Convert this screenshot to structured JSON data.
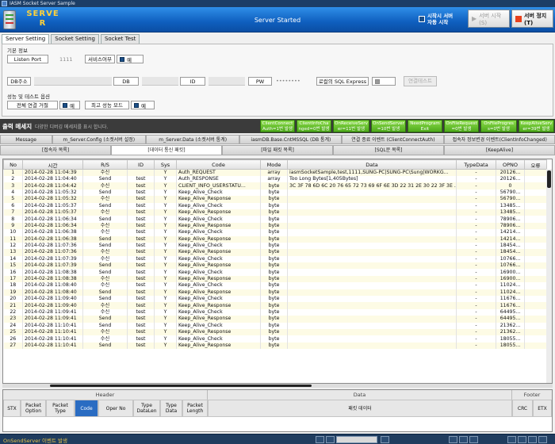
{
  "window": {
    "title": "IASM Socket Server Sample"
  },
  "banner": {
    "brand_line1": "SERVE",
    "brand_line2": "R",
    "status": "Server Started",
    "auto_start_line1": "시작시 서버",
    "auto_start_line2": "자동 시작",
    "start_button": "서버 시작(S)",
    "stop_button": "서버 정지(T)"
  },
  "tabs": [
    "Server Setting",
    "Socket Setting",
    "Socket Test"
  ],
  "settings": {
    "basic_group": "기본 정보",
    "listen_port_label": "Listen Port",
    "listen_port_value": "1111",
    "service_label": "서비스여부",
    "service_value": "예",
    "db_label": "DB주소",
    "db_name_label": "DB",
    "id_label": "ID",
    "pw_label": "PW",
    "pw_value": "••••••••",
    "local_sql_label": "로컬의 SQL Express",
    "connect_button": "연결테스트",
    "perf_group": "성능 및 테스트 옵션",
    "deny_all_label": "전체 연결 거절",
    "deny_all_value": "예",
    "max_perf_label": "최고 성능 모드",
    "max_perf_value": "예"
  },
  "messages": {
    "title": "출력 메세지",
    "subtitle": "다양한 디버깅 메세지를 표시 합니다.",
    "event_buttons": [
      {
        "line1": "ClientConnect",
        "line2": "Auth=1번 발생"
      },
      {
        "line1": "ClientInfoCha",
        "line2": "nged=0번 발생"
      },
      {
        "line1": "OnReceiveServ",
        "line2": "er=11번 발생"
      },
      {
        "line1": "OnSendServer",
        "line2": "=10번 발생"
      },
      {
        "line1": "NeedProgram",
        "line2": "Exit"
      },
      {
        "line1": "OnFileRequest",
        "line2": "=0번 발생"
      },
      {
        "line1": "OnFileProgres",
        "line2": "s=0번 발생"
      },
      {
        "line1": "KeepAliveServ",
        "line2": "er=39번 발생"
      }
    ]
  },
  "msg_tabs_row1": [
    "Message",
    "m_Server.Config (소켓서버 설정)",
    "m_Server.Data (소켓서버 통계)",
    "iasmDB.Base.CntMSSQL (DB 통계)",
    "연결 종료 이벤트 (ClientConnectAuth)",
    "접속자 정보변경 이벤트(ClientInfoChanged)"
  ],
  "msg_tabs_row2": [
    "[접속자 목록]",
    "[데이터 통신 패킷]",
    "[파일 패킷 목록]",
    "[SQL문 목록]",
    "[KeepAlive]"
  ],
  "grid": {
    "columns": [
      "No",
      "시간",
      "R/S",
      "ID",
      "Sys",
      "Code",
      "Mode",
      "Data",
      "TypeData",
      "OPNO",
      "오류"
    ],
    "rows": [
      [
        "1",
        "2014-02-28 11:04:39",
        "수신",
        "",
        "Y",
        "Auth_REQUEST",
        "array",
        "iasmSocketSample,test,1111,SUNG-PC|SUNG-PC\\Sung|WORKG...",
        "-",
        "20126...",
        ""
      ],
      [
        "2",
        "2014-02-28 11:04:40",
        "Send",
        "test",
        "Y",
        "Auth_RESPONSE",
        "array",
        "Too Long Bytes[1,405Bytes]",
        "-",
        "20126...",
        ""
      ],
      [
        "3",
        "2014-02-28 11:04:42",
        "수신",
        "test",
        "Y",
        "CLIENT_INFO_USERSTATU...",
        "byte",
        "3C 3F 78 6D 6C 20 76 65 72 73 69 6F 6E 3D 22 31 2E 30 22 3F 3E ...",
        "-",
        "0",
        ""
      ],
      [
        "4",
        "2014-02-28 11:05:32",
        "Send",
        "test",
        "Y",
        "Keep_Alive_Check",
        "byte",
        "",
        "-",
        "56790...",
        ""
      ],
      [
        "5",
        "2014-02-28 11:05:32",
        "수신",
        "test",
        "Y",
        "Keep_Alive_Response",
        "byte",
        "",
        "-",
        "56790...",
        ""
      ],
      [
        "6",
        "2014-02-28 11:05:37",
        "Send",
        "test",
        "Y",
        "Keep_Alive_Check",
        "byte",
        "",
        "-",
        "13485...",
        ""
      ],
      [
        "7",
        "2014-02-28 11:05:37",
        "수신",
        "test",
        "Y",
        "Keep_Alive_Response",
        "byte",
        "",
        "-",
        "13485...",
        ""
      ],
      [
        "8",
        "2014-02-28 11:06:34",
        "Send",
        "test",
        "Y",
        "Keep_Alive_Check",
        "byte",
        "",
        "-",
        "78906...",
        ""
      ],
      [
        "9",
        "2014-02-28 11:06:34",
        "수신",
        "test",
        "Y",
        "Keep_Alive_Response",
        "byte",
        "",
        "-",
        "78906...",
        ""
      ],
      [
        "10",
        "2014-02-28 11:06:38",
        "수신",
        "test",
        "Y",
        "Keep_Alive_Check",
        "byte",
        "",
        "-",
        "14214...",
        ""
      ],
      [
        "11",
        "2014-02-28 11:06:38",
        "Send",
        "test",
        "Y",
        "Keep_Alive_Response",
        "byte",
        "",
        "-",
        "14214...",
        ""
      ],
      [
        "12",
        "2014-02-28 11:07:36",
        "Send",
        "test",
        "Y",
        "Keep_Alive_Check",
        "byte",
        "",
        "-",
        "18454...",
        ""
      ],
      [
        "13",
        "2014-02-28 11:07:36",
        "수신",
        "test",
        "Y",
        "Keep_Alive_Response",
        "byte",
        "",
        "-",
        "18454...",
        ""
      ],
      [
        "14",
        "2014-02-28 11:07:39",
        "수신",
        "test",
        "Y",
        "Keep_Alive_Check",
        "byte",
        "",
        "-",
        "10766...",
        ""
      ],
      [
        "15",
        "2014-02-28 11:07:39",
        "Send",
        "test",
        "Y",
        "Keep_Alive_Response",
        "byte",
        "",
        "-",
        "10766...",
        ""
      ],
      [
        "16",
        "2014-02-28 11:08:38",
        "Send",
        "test",
        "Y",
        "Keep_Alive_Check",
        "byte",
        "",
        "-",
        "16900...",
        ""
      ],
      [
        "17",
        "2014-02-28 11:08:38",
        "수신",
        "test",
        "Y",
        "Keep_Alive_Response",
        "byte",
        "",
        "-",
        "16900...",
        ""
      ],
      [
        "18",
        "2014-02-28 11:08:40",
        "수신",
        "test",
        "Y",
        "Keep_Alive_Check",
        "byte",
        "",
        "-",
        "11024...",
        ""
      ],
      [
        "19",
        "2014-02-28 11:08:40",
        "Send",
        "test",
        "Y",
        "Keep_Alive_Response",
        "byte",
        "",
        "-",
        "11024...",
        ""
      ],
      [
        "20",
        "2014-02-28 11:09:40",
        "Send",
        "test",
        "Y",
        "Keep_Alive_Check",
        "byte",
        "",
        "-",
        "11676...",
        ""
      ],
      [
        "21",
        "2014-02-28 11:09:40",
        "수신",
        "test",
        "Y",
        "Keep_Alive_Response",
        "byte",
        "",
        "-",
        "11676...",
        ""
      ],
      [
        "22",
        "2014-02-28 11:09:41",
        "수신",
        "test",
        "Y",
        "Keep_Alive_Check",
        "byte",
        "",
        "-",
        "64495...",
        ""
      ],
      [
        "23",
        "2014-02-28 11:09:41",
        "Send",
        "test",
        "Y",
        "Keep_Alive_Response",
        "byte",
        "",
        "-",
        "64495...",
        ""
      ],
      [
        "24",
        "2014-02-28 11:10:41",
        "Send",
        "test",
        "Y",
        "Keep_Alive_Check",
        "byte",
        "",
        "-",
        "21362...",
        ""
      ],
      [
        "25",
        "2014-02-28 11:10:41",
        "수신",
        "test",
        "Y",
        "Keep_Alive_Response",
        "byte",
        "",
        "-",
        "21362...",
        ""
      ],
      [
        "26",
        "2014-02-28 11:10:41",
        "수신",
        "test",
        "Y",
        "Keep_Alive_Check",
        "byte",
        "",
        "-",
        "18055...",
        ""
      ],
      [
        "27",
        "2014-02-28 11:10:41",
        "Send",
        "test",
        "Y",
        "Keep_Alive_Response",
        "byte",
        "",
        "-",
        "18055...",
        ""
      ]
    ]
  },
  "packet": {
    "header_group": "Header",
    "data_group": "Data",
    "footer_group": "Footer",
    "cols": {
      "stx": "STX",
      "opt_l1": "Packet",
      "opt_l2": "Option",
      "type_l1": "Packet",
      "type_l2": "Type",
      "code": "Code",
      "operno": "Oper No",
      "tdl_l1": "Type",
      "tdl_l2": "DataLen",
      "td_l1": "Type",
      "td_l2": "Data",
      "len_l1": "Packet",
      "len_l2": "Length",
      "packet_data": "패킷 데이터",
      "crc": "CRC",
      "etx": "ETX"
    }
  },
  "status": {
    "text": "OnSendServer 이벤트 발생"
  },
  "colors": {
    "accent": "#0f5fbf",
    "event_green": "#4faa1c",
    "status_bg": "#1f3c5e",
    "status_text": "#e8c34a"
  }
}
